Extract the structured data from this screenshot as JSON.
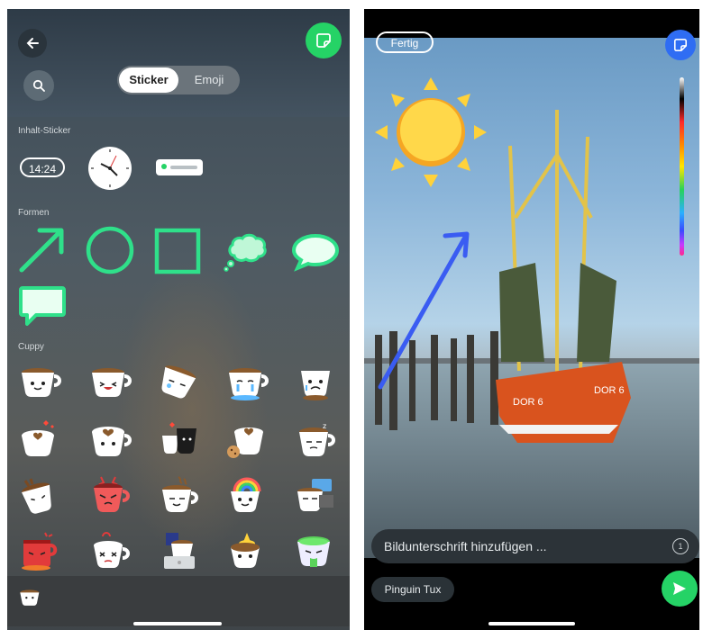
{
  "left_panel": {
    "tabs": [
      {
        "label": "Sticker",
        "selected": true
      },
      {
        "label": "Emoji",
        "selected": false
      }
    ],
    "sections": {
      "content": "Inhalt-Sticker",
      "shapes": "Formen",
      "cuppy": "Cuppy"
    },
    "time_sticker": "14:24",
    "accent_color": "#25d366",
    "icons": {
      "back": "arrow-left-icon",
      "sticker": "sticker-icon",
      "search": "search-icon"
    }
  },
  "right_panel": {
    "done_label": "Fertig",
    "caption_placeholder": "Bildunterschrift hinzufügen ...",
    "timer_label": "1",
    "recipient": "Pinguin Tux",
    "boat_text_left": "DOR 6",
    "boat_text_right": "DOR 6",
    "send_color": "#25d366",
    "sticker_button_color": "#2f6df3"
  }
}
